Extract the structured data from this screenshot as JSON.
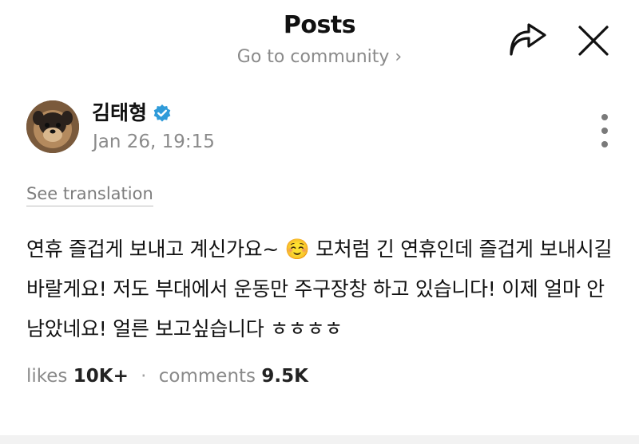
{
  "header": {
    "title": "Posts",
    "community_link": "Go to community ›",
    "share_icon": "share-arrow-icon",
    "close_icon": "close-icon"
  },
  "author": {
    "name": "김태형",
    "timestamp": "Jan 26, 19:15",
    "verified_icon": "verified-badge-icon",
    "verified_color": "#2f9bd9"
  },
  "post": {
    "see_translation": "See translation",
    "body": "연휴 즐겁게 보내고 계신가요~ ☺️ 모처럼 긴 연휴인데 즐겁게 보내시길 바랄게요! 저도 부대에서 운동만 주구장창 하고 있습니다! 이제 얼마 안남았네요! 얼른 보고싶습니다 ㅎㅎㅎㅎ"
  },
  "stats": {
    "likes_label": "likes",
    "likes_value": "10K+",
    "separator": "·",
    "comments_label": "comments",
    "comments_value": "9.5K"
  }
}
